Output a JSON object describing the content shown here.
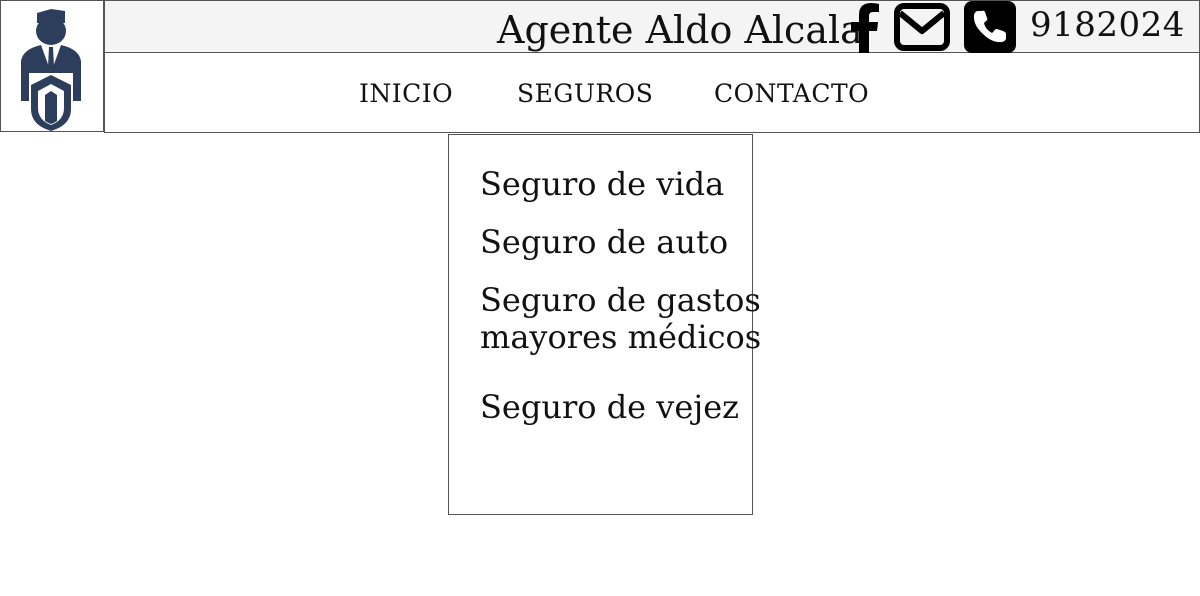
{
  "header": {
    "agent_name": "Agente Aldo Alcala",
    "phone_number": "9182024",
    "icons": [
      "facebook-icon",
      "envelope-icon",
      "phone-icon"
    ],
    "logo": "agent-shield-logo"
  },
  "nav": {
    "items": [
      {
        "label": "INICIO"
      },
      {
        "label": "SEGUROS"
      },
      {
        "label": "CONTACTO"
      }
    ]
  },
  "dropdown": {
    "items": [
      {
        "label": "Seguro de vida"
      },
      {
        "label": "Seguro de auto"
      },
      {
        "label_line1": "Seguro de gastos",
        "label_line2": "mayores médicos"
      },
      {
        "label": "Seguro de vejez"
      }
    ]
  },
  "colors": {
    "logo_navy": "#2c3e5c",
    "header_bg": "#f4f4f4",
    "border": "#555555",
    "text": "#111111"
  }
}
